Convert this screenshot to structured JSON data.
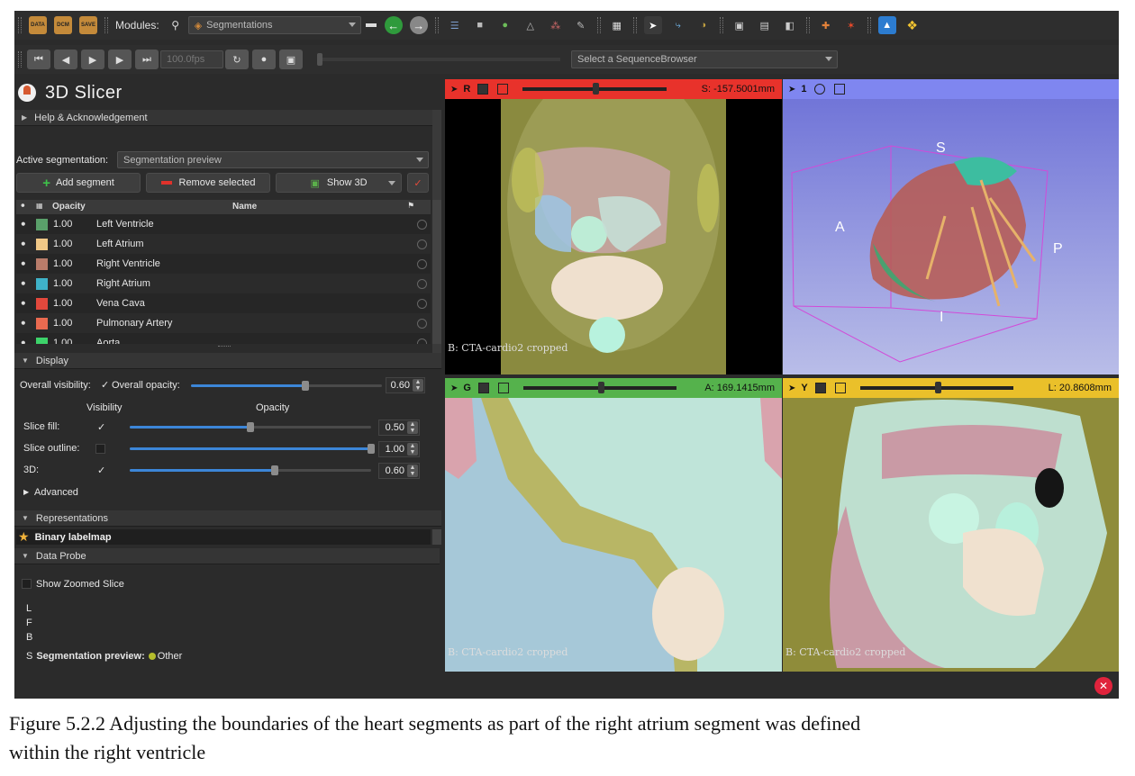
{
  "toolbar": {
    "data_icons": [
      "DATA",
      "DCM",
      "SAVE"
    ],
    "modules_label": "Modules:",
    "module_selected": "Segmentations",
    "fps_value": "100.0fps",
    "sequence_browser": "Select a SequenceBrowser"
  },
  "app": {
    "title": "3D Slicer"
  },
  "panel": {
    "help_section": "Help & Acknowledgement",
    "active_segmentation_label": "Active segmentation:",
    "active_segmentation_value": "Segmentation preview",
    "add_segment": "Add segment",
    "remove_selected": "Remove selected",
    "show_3d": "Show 3D",
    "table_headers": {
      "opacity": "Opacity",
      "name": "Name"
    },
    "segments": [
      {
        "opacity": "1.00",
        "name": "Left Ventricle",
        "color": "#5aa06a"
      },
      {
        "opacity": "1.00",
        "name": "Left Atrium",
        "color": "#f0c887"
      },
      {
        "opacity": "1.00",
        "name": "Right Ventricle",
        "color": "#b97c6a"
      },
      {
        "opacity": "1.00",
        "name": "Right Atrium",
        "color": "#3fb2c8"
      },
      {
        "opacity": "1.00",
        "name": "Vena Cava",
        "color": "#e2483c"
      },
      {
        "opacity": "1.00",
        "name": "Pulmonary Artery",
        "color": "#e96a50"
      },
      {
        "opacity": "1.00",
        "name": "Aorta",
        "color": "#3dd36a"
      }
    ],
    "display_section": "Display",
    "overall_visibility": "Overall visibility:",
    "overall_opacity": "Overall opacity:",
    "overall_opacity_value": "0.60",
    "overall_opacity_level": 0.6,
    "visibility_header": "Visibility",
    "opacity_header": "Opacity",
    "display_rows": [
      {
        "label": "Slice fill:",
        "checked": true,
        "value": "0.50",
        "level": 0.5
      },
      {
        "label": "Slice outline:",
        "checked": false,
        "value": "1.00",
        "level": 1.0
      },
      {
        "label": "3D:",
        "checked": true,
        "value": "0.60",
        "level": 0.6
      }
    ],
    "advanced": "Advanced",
    "representations_section": "Representations",
    "representation_item": "Binary labelmap",
    "data_probe_section": "Data Probe",
    "show_zoomed_slice": "Show Zoomed Slice",
    "probe_lines": [
      "L",
      "F",
      "B"
    ],
    "probe_s_prefix": "S",
    "probe_segmentation": "Segmentation preview:",
    "probe_value": "Other"
  },
  "views": {
    "red": {
      "name": "R",
      "offset": "S: -157.5001mm",
      "volume_label": "B: CTA-cardio2 cropped",
      "color": "#e8322b",
      "slider_level": 0.49
    },
    "threed": {
      "name": "1",
      "color": "#7f86f0",
      "orientation": [
        "S",
        "A",
        "P",
        "I"
      ]
    },
    "green": {
      "name": "G",
      "offset": "A: 169.1415mm",
      "volume_label": "B: CTA-cardio2 cropped",
      "color": "#55b24c",
      "slider_level": 0.49
    },
    "yellow": {
      "name": "Y",
      "offset": "L: 20.8608mm",
      "volume_label": "B: CTA-cardio2 cropped",
      "color": "#eac02a",
      "slider_level": 0.49
    }
  },
  "caption": {
    "line1": "Figure 5.2.2 Adjusting the boundaries of the heart segments as part of the right atrium segment was defined",
    "line2": "within the right ventricle"
  }
}
